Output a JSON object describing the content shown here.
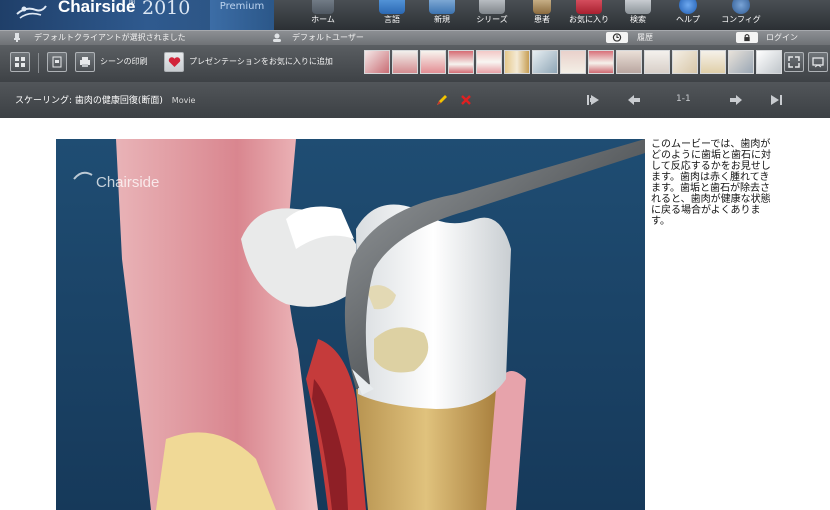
{
  "app": {
    "brand": "Chairside",
    "year": "2010",
    "edition": "Premium"
  },
  "nav": [
    {
      "label": "ホーム",
      "icon": "home-icon"
    },
    {
      "label": "言語",
      "icon": "language-icon"
    },
    {
      "label": "新規",
      "icon": "new-icon"
    },
    {
      "label": "シリーズ",
      "icon": "series-icon"
    },
    {
      "label": "患者",
      "icon": "patient-icon"
    },
    {
      "label": "お気に入り",
      "icon": "favorites-icon"
    },
    {
      "label": "検索",
      "icon": "search-icon"
    },
    {
      "label": "ヘルプ",
      "icon": "help-icon"
    },
    {
      "label": "コンフィグ",
      "icon": "config-icon"
    }
  ],
  "status": {
    "client": "デフォルトクライアントが選択されました",
    "user": "デフォルトユーザー",
    "history": "履歴",
    "login": "ログイン"
  },
  "toolbar": {
    "print_scenes": "シーンの印刷",
    "add_favorite": "プレゼンテーションをお気に入りに追加"
  },
  "scene": {
    "title": "スケーリング: 歯肉の健康回復(断面)",
    "type": "Movie",
    "page": "1-1"
  },
  "video": {
    "watermark": "Chairside"
  },
  "description": "このムービーでは、歯肉がどのように歯垢と歯石に対して反応するかをお見せします。歯肉は赤く腫れてきます。歯垢と歯石が除去されると、歯肉が健康な状態に戻る場合がよくあります。",
  "colors": {
    "accent_blue": "#2f5a8f",
    "video_bg": "#1e4a6e",
    "gum_pink": "#e7a3ab",
    "edit_yellow": "#f2c400",
    "delete_red": "#e02020"
  }
}
